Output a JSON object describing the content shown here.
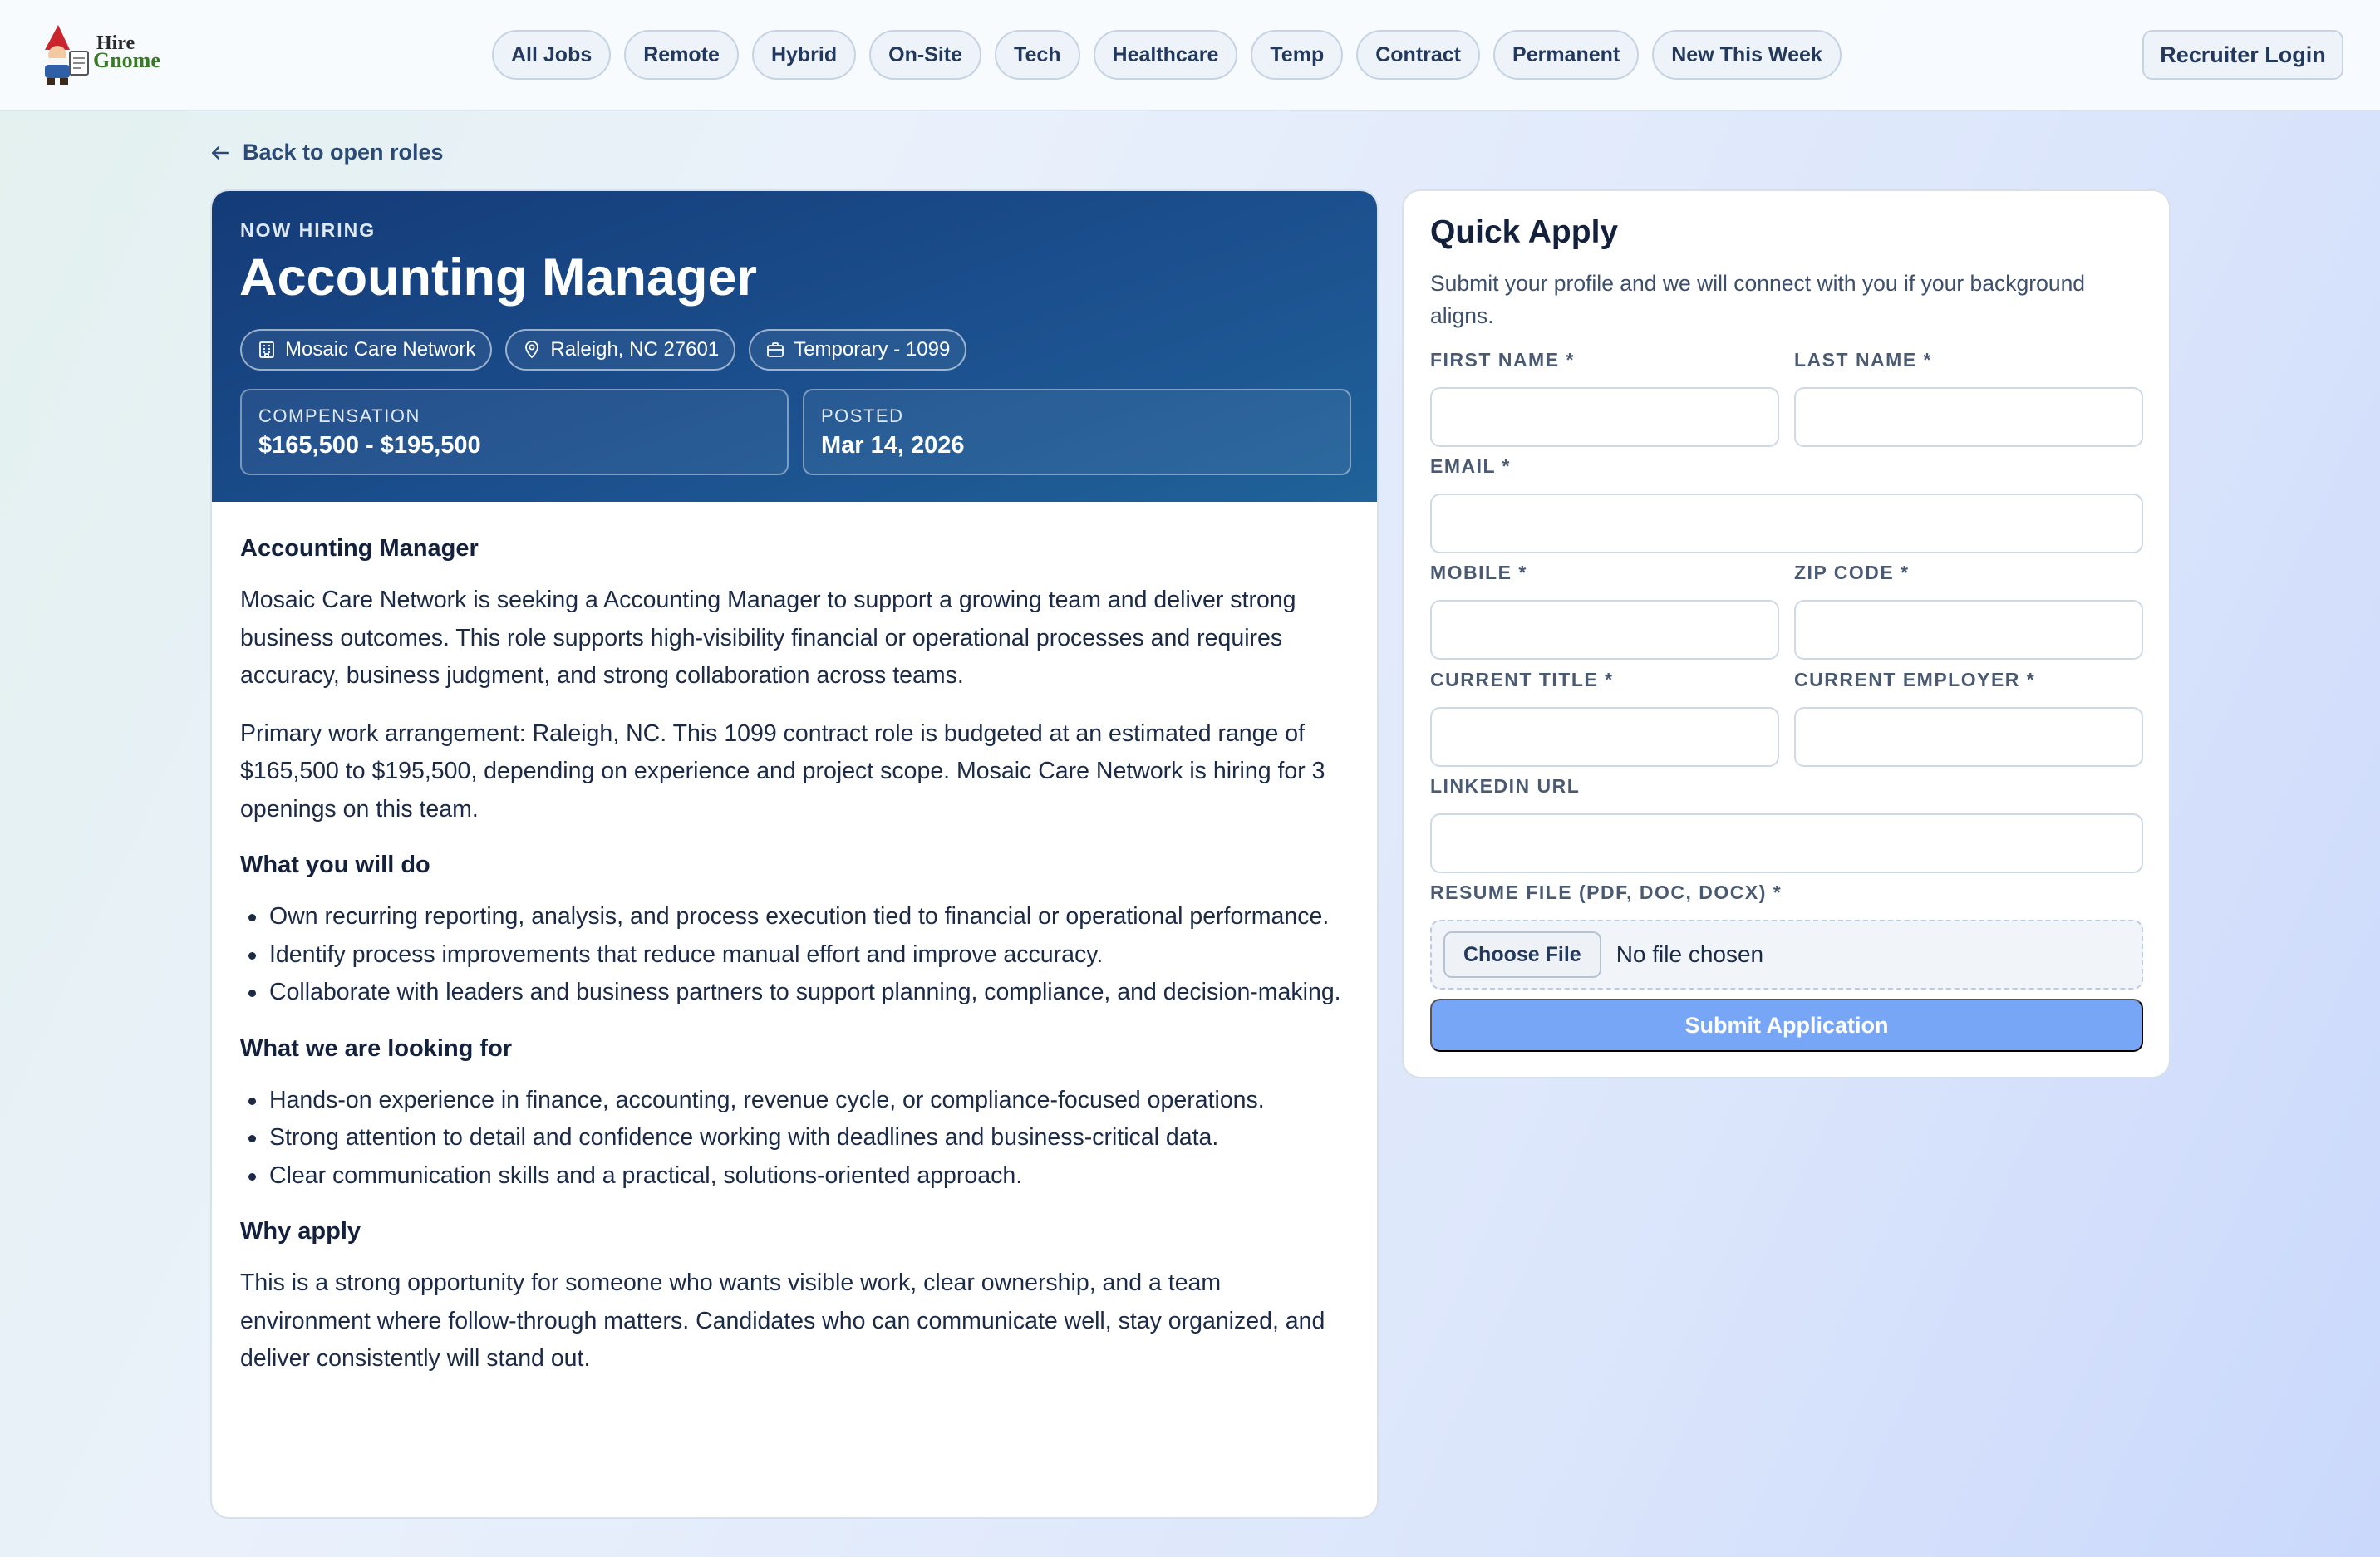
{
  "brand": {
    "logo_line1": "Hire",
    "logo_line2": "Gnome"
  },
  "nav": {
    "pills": [
      {
        "label": "All Jobs"
      },
      {
        "label": "Remote"
      },
      {
        "label": "Hybrid"
      },
      {
        "label": "On-Site"
      },
      {
        "label": "Tech"
      },
      {
        "label": "Healthcare"
      },
      {
        "label": "Temp"
      },
      {
        "label": "Contract"
      },
      {
        "label": "Permanent"
      },
      {
        "label": "New This Week"
      }
    ],
    "recruiter_login": "Recruiter Login"
  },
  "back_link": "Back to open roles",
  "job": {
    "eyebrow": "NOW HIRING",
    "title": "Accounting Manager",
    "chips": {
      "company": "Mosaic Care Network",
      "location": "Raleigh, NC 27601",
      "type": "Temporary - 1099"
    },
    "compensation_label": "COMPENSATION",
    "compensation_value": "$165,500 - $195,500",
    "posted_label": "POSTED",
    "posted_value": "Mar 14, 2026",
    "description": {
      "heading": "Accounting Manager",
      "intro": "Mosaic Care Network is seeking a Accounting Manager to support a growing team and deliver strong business outcomes. This role supports high-visibility financial or operational processes and requires accuracy, business judgment, and strong collaboration across teams.",
      "arrangement": "Primary work arrangement: Raleigh, NC. This 1099 contract role is budgeted at an estimated range of $165,500 to $195,500, depending on experience and project scope. Mosaic Care Network is hiring for 3 openings on this team.",
      "do_heading": "What you will do",
      "do_items": [
        "Own recurring reporting, analysis, and process execution tied to financial or operational performance.",
        "Identify process improvements that reduce manual effort and improve accuracy.",
        "Collaborate with leaders and business partners to support planning, compliance, and decision-making."
      ],
      "look_heading": "What we are looking for",
      "look_items": [
        "Hands-on experience in finance, accounting, revenue cycle, or compliance-focused operations.",
        "Strong attention to detail and confidence working with deadlines and business-critical data.",
        "Clear communication skills and a practical, solutions-oriented approach."
      ],
      "why_heading": "Why apply",
      "why_text": "This is a strong opportunity for someone who wants visible work, clear ownership, and a team environment where follow-through matters. Candidates who can communicate well, stay organized, and deliver consistently will stand out."
    }
  },
  "apply": {
    "title": "Quick Apply",
    "subtitle": "Submit your profile and we will connect with you if your background aligns.",
    "fields": {
      "first_name": {
        "label": "FIRST NAME *",
        "value": ""
      },
      "last_name": {
        "label": "LAST NAME *",
        "value": ""
      },
      "email": {
        "label": "EMAIL *",
        "value": ""
      },
      "mobile": {
        "label": "MOBILE *",
        "value": ""
      },
      "zip": {
        "label": "ZIP CODE *",
        "value": ""
      },
      "current_title": {
        "label": "CURRENT TITLE *",
        "value": ""
      },
      "current_employer": {
        "label": "CURRENT EMPLOYER *",
        "value": ""
      },
      "linkedin": {
        "label": "LINKEDIN URL",
        "value": ""
      },
      "resume": {
        "label": "RESUME FILE (PDF, DOC, DOCX) *",
        "button": "Choose File",
        "status": "No file chosen"
      }
    },
    "submit": "Submit Application"
  },
  "colors": {
    "hero_start": "#143b78",
    "hero_end": "#206299",
    "submit_button": "#78a6f6",
    "text_primary": "#14213d"
  },
  "icons": {
    "back": "arrow-left-icon",
    "company": "building-icon",
    "location": "map-pin-icon",
    "type": "briefcase-icon"
  }
}
